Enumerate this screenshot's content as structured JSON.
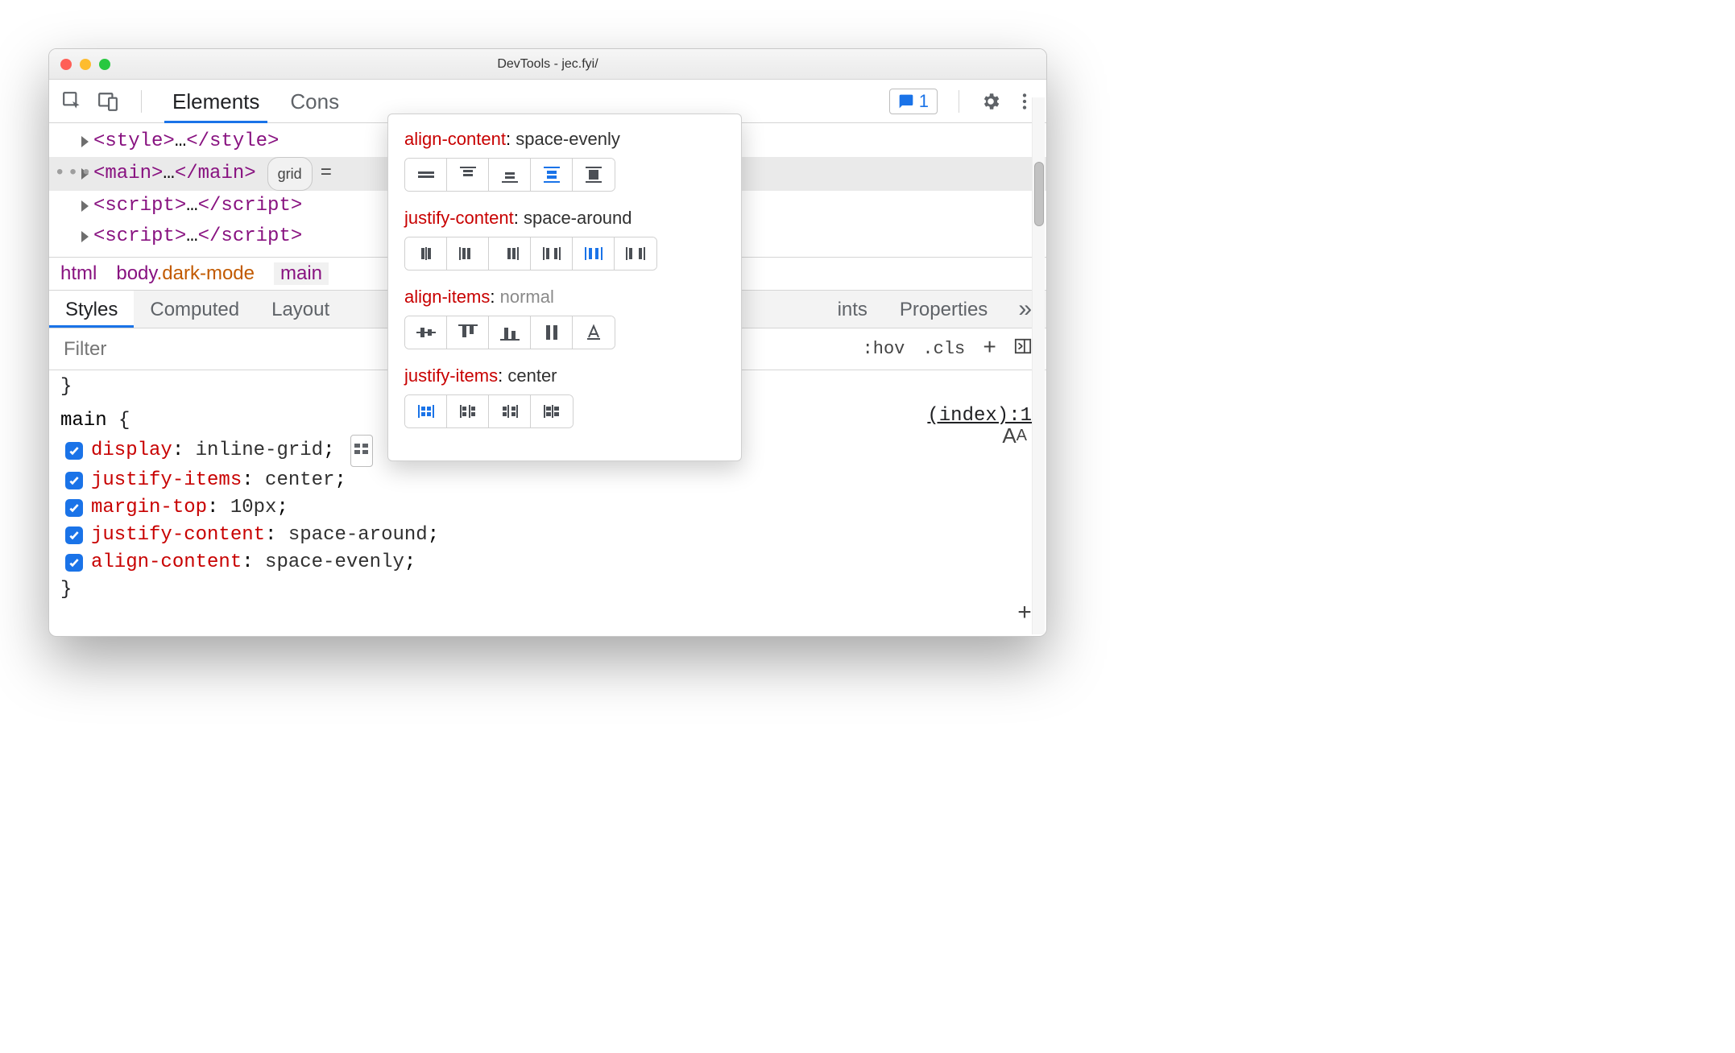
{
  "titlebar": {
    "title": "DevTools - jec.fyi/"
  },
  "toolbar": {
    "tabs": [
      "Elements",
      "Cons"
    ],
    "activeTabIndex": 0,
    "feedbackCount": "1"
  },
  "dom": {
    "rows": [
      {
        "open": "<style>",
        "mid": "…",
        "close": "</style>",
        "selected": false
      },
      {
        "open": "<main>",
        "mid": "…",
        "close": "</main>",
        "selected": true,
        "badge": "grid",
        "trail": "="
      },
      {
        "open": "<script>",
        "mid": "…",
        "close": "</script>",
        "selected": false
      },
      {
        "open": "<script>",
        "mid": "…",
        "close": "</script>",
        "selected": false
      }
    ]
  },
  "crumbs": {
    "items": [
      {
        "text": "html"
      },
      {
        "text": "body",
        "class": ".dark-mode"
      },
      {
        "text": "main",
        "active": true
      }
    ]
  },
  "subtabs": {
    "items": [
      "Styles",
      "Computed",
      "Layout",
      "ints",
      "Properties"
    ],
    "activeIndex": 0
  },
  "filter": {
    "placeholder": "Filter",
    "hov": ":hov",
    "cls": ".cls"
  },
  "styles": {
    "selector": "main",
    "source": "(index):1",
    "declarations": [
      {
        "prop": "display",
        "val": "inline-grid",
        "grid_editor": true
      },
      {
        "prop": "justify-items",
        "val": "center"
      },
      {
        "prop": "margin-top",
        "val": "10px"
      },
      {
        "prop": "justify-content",
        "val": "space-around"
      },
      {
        "prop": "align-content",
        "val": "space-evenly"
      }
    ],
    "closing_brace_top": "}"
  },
  "popup": {
    "sections": [
      {
        "prop": "align-content",
        "val": "space-evenly",
        "muted": false,
        "iconset": "ac",
        "activeIndex": 3,
        "count": 5
      },
      {
        "prop": "justify-content",
        "val": "space-around",
        "muted": false,
        "iconset": "jc",
        "activeIndex": 4,
        "count": 6
      },
      {
        "prop": "align-items",
        "val": "normal",
        "muted": true,
        "iconset": "ai",
        "activeIndex": -1,
        "count": 5
      },
      {
        "prop": "justify-items",
        "val": "center",
        "muted": false,
        "iconset": "ji",
        "activeIndex": 0,
        "count": 4
      }
    ]
  }
}
